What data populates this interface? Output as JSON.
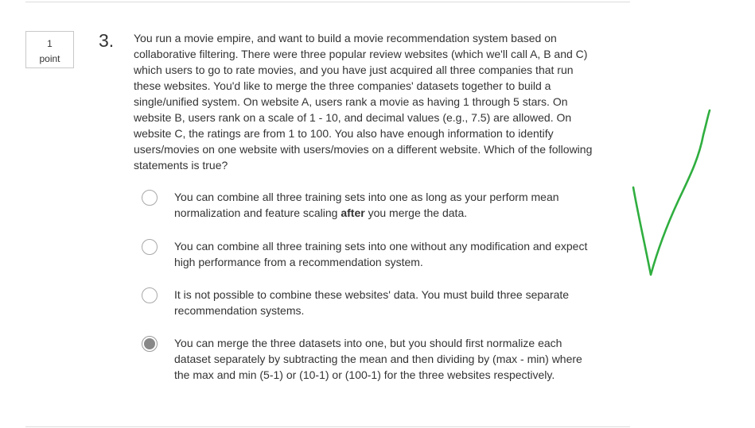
{
  "question": {
    "points_value": "1",
    "points_label": "point",
    "number": "3.",
    "text": "You run a movie empire, and want to build a movie recommendation system based on collaborative filtering. There were three popular review websites (which we'll call A, B and C) which users to go to rate movies, and you have just acquired all three companies that run these websites. You'd like to merge the three companies' datasets together to build a single/unified system. On website A, users rank a movie as having 1 through 5 stars. On website B, users rank on a scale of 1 - 10, and decimal values (e.g., 7.5) are allowed. On website C, the ratings are from 1 to 100. You also have enough information to identify users/movies on one website with users/movies on a different website. Which of the following statements is true?"
  },
  "options": [
    {
      "text_before": "You can combine all three training sets into one as long as your perform mean normalization and feature scaling ",
      "text_bold": "after",
      "text_after": " you merge the data.",
      "selected": false
    },
    {
      "text": "You can combine all three training sets into one without any modification and expect high performance from a recommendation system.",
      "selected": false
    },
    {
      "text": "It is not possible to combine these websites' data. You must build three separate recommendation systems.",
      "selected": false
    },
    {
      "text": "You can merge the three datasets into one, but you should first normalize each dataset separately by subtracting the mean and then dividing by (max - min) where the max and min (5-1) or (10-1) or (100-1) for the three websites respectively.",
      "selected": true
    }
  ],
  "annotation": {
    "icon": "checkmark-icon",
    "color": "#2fae3f"
  }
}
